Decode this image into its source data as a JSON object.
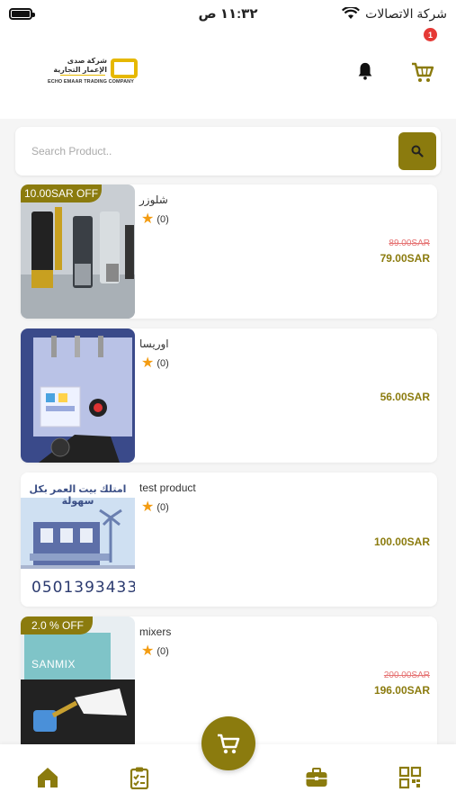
{
  "status_bar": {
    "time": "١١:٣٢ ص",
    "carrier": "شركة الاتصالات"
  },
  "header": {
    "logo_text_ar": "شركة صدى الإعمار التجارية",
    "logo_text_en": "ECHO EMAAR TRADING COMPANY",
    "cart_badge": "1"
  },
  "search": {
    "placeholder": "Search Product.."
  },
  "products": [
    {
      "name": "شلوزر",
      "rating": "(0)",
      "discount": "10.00SAR OFF",
      "old_price": "89.00SAR",
      "price": "79.00SAR"
    },
    {
      "name": "اوريسا",
      "rating": "(0)",
      "discount": "",
      "old_price": "",
      "price": "56.00SAR"
    },
    {
      "name": "test product",
      "rating": "(0)",
      "discount": "",
      "old_price": "",
      "price": "100.00SAR",
      "image_text_ar": "امتلك بيت العمر بكل سهولة",
      "image_phone": "0501393433"
    },
    {
      "name": "mixers",
      "rating": "(0)",
      "discount": "2.0 % OFF",
      "old_price": "200.00SAR",
      "price": "196.00SAR",
      "image_brand": "SANMIX"
    }
  ],
  "colors": {
    "accent": "#8b7b0e",
    "badge_red": "#e53935",
    "star": "#f39c12",
    "old_price": "#e57373"
  },
  "icons": [
    "battery-icon",
    "wifi-icon",
    "bell-icon",
    "cart-icon",
    "search-icon",
    "home-icon",
    "orders-icon",
    "briefcase-icon",
    "qr-icon",
    "star-icon"
  ]
}
